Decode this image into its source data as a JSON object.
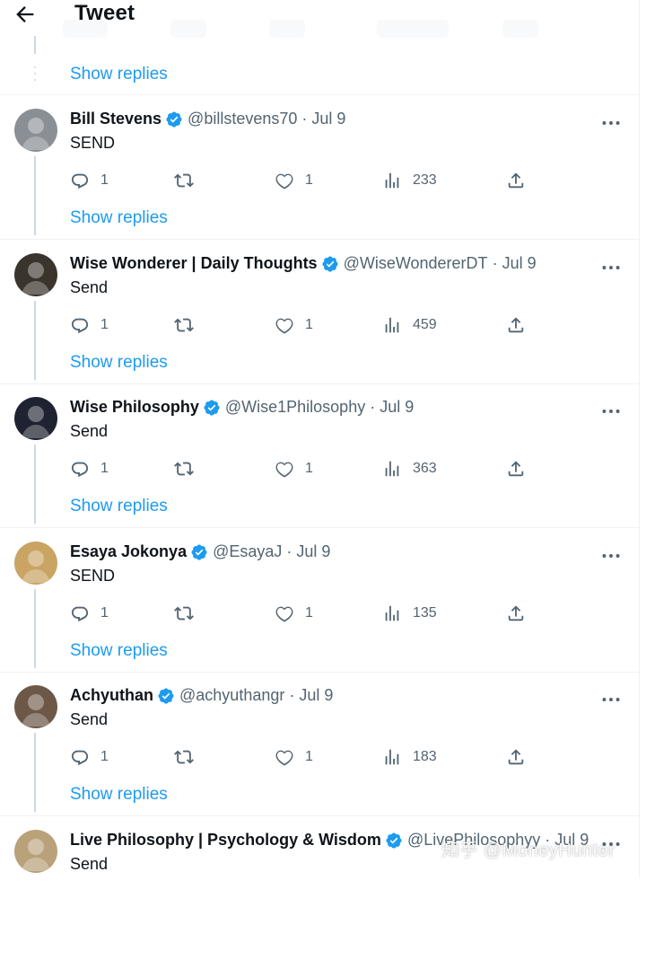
{
  "header": {
    "title": "Tweet"
  },
  "show_replies_label": "Show replies",
  "tweets": [
    {
      "name": "Bill Stevens",
      "handle": "@billstevens70",
      "separator": "·",
      "date": "Jul 9",
      "text": "SEND",
      "replies": "1",
      "likes": "1",
      "views": "233",
      "avatar_color": "#8a8f96"
    },
    {
      "name": "Wise Wonderer | Daily Thoughts",
      "handle": "@WiseWondererDT",
      "separator": "·",
      "date": "Jul 9",
      "text": "Send",
      "replies": "1",
      "likes": "1",
      "views": "459",
      "avatar_color": "#3b342c"
    },
    {
      "name": "Wise Philosophy",
      "handle": "@Wise1Philosophy",
      "separator": "·",
      "date": "Jul 9",
      "text": "Send",
      "replies": "1",
      "likes": "1",
      "views": "363",
      "avatar_color": "#1f2230"
    },
    {
      "name": "Esaya Jokonya",
      "handle": "@EsayaJ",
      "separator": "·",
      "date": "Jul 9",
      "text": "SEND",
      "replies": "1",
      "likes": "1",
      "views": "135",
      "avatar_color": "#c9a463"
    },
    {
      "name": "Achyuthan",
      "handle": "@achyuthangr",
      "separator": "·",
      "date": "Jul 9",
      "text": "Send",
      "replies": "1",
      "likes": "1",
      "views": "183",
      "avatar_color": "#6d5848"
    },
    {
      "name": "Live Philosophy | Psychology & Wisdom",
      "handle": "@LivePhilosophyy",
      "separator": "·",
      "date": "Jul 9",
      "text": "Send",
      "avatar_color": "#b9a27a"
    }
  ],
  "watermark": "知乎 @MoneyHunter",
  "colors": {
    "link": "#1d9bf0",
    "secondary_text": "#536471",
    "verified": "#1d9bf0",
    "thread_line": "#cfd9de"
  }
}
